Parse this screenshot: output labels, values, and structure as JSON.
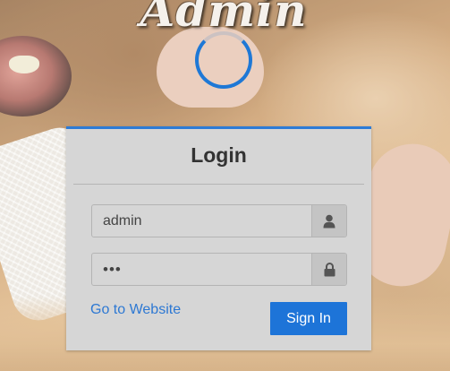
{
  "logo": {
    "text": "Admin"
  },
  "login": {
    "title": "Login",
    "username": {
      "value": "admin",
      "icon": "user-icon"
    },
    "password": {
      "masked_value": "•••",
      "icon": "lock-icon"
    },
    "website_link": "Go to Website",
    "signin_button": "Sign In"
  },
  "colors": {
    "accent": "#1d74d8",
    "panel_bg": "#d6d6d6",
    "link": "#2d78d3",
    "spinner": "#1e78d6"
  }
}
